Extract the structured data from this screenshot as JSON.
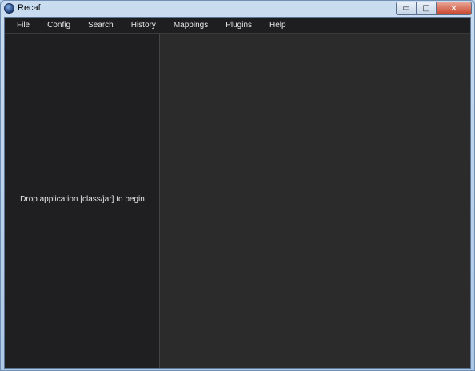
{
  "window": {
    "title": "Recaf",
    "controls": {
      "minimize": "▭",
      "maximize": "□",
      "close": "✕"
    }
  },
  "menubar": {
    "items": [
      "File",
      "Config",
      "Search",
      "History",
      "Mappings",
      "Plugins",
      "Help"
    ]
  },
  "workspace": {
    "drop_hint": "Drop application [class/jar] to begin"
  },
  "colors": {
    "menubar_bg": "#1e1e20",
    "left_panel_bg": "#1f1f21",
    "editor_bg": "#2b2b2b",
    "text": "#e6e6e6"
  }
}
